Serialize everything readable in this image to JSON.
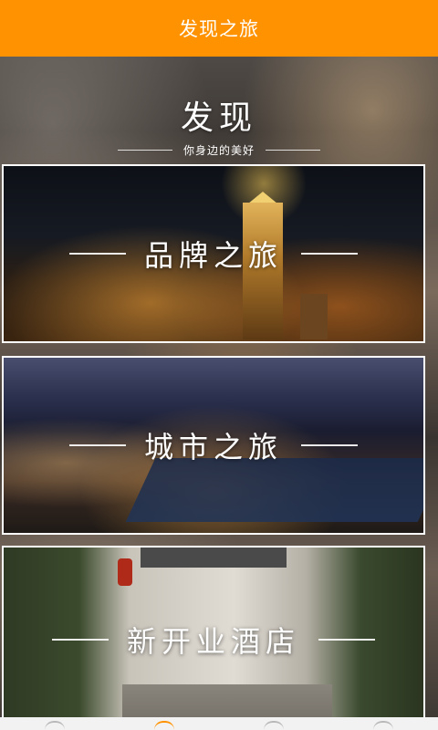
{
  "app_title": "发现之旅",
  "hero": {
    "title": "发现",
    "subtitle": "你身边的美好"
  },
  "cards": [
    {
      "label": "品牌之旅"
    },
    {
      "label": "城市之旅"
    },
    {
      "label": "新开业酒店"
    }
  ],
  "colors": {
    "accent": "#ff9200",
    "text_light": "#ffffff"
  },
  "icons": [
    "home-icon",
    "discover-icon",
    "tag-icon",
    "user-icon"
  ]
}
